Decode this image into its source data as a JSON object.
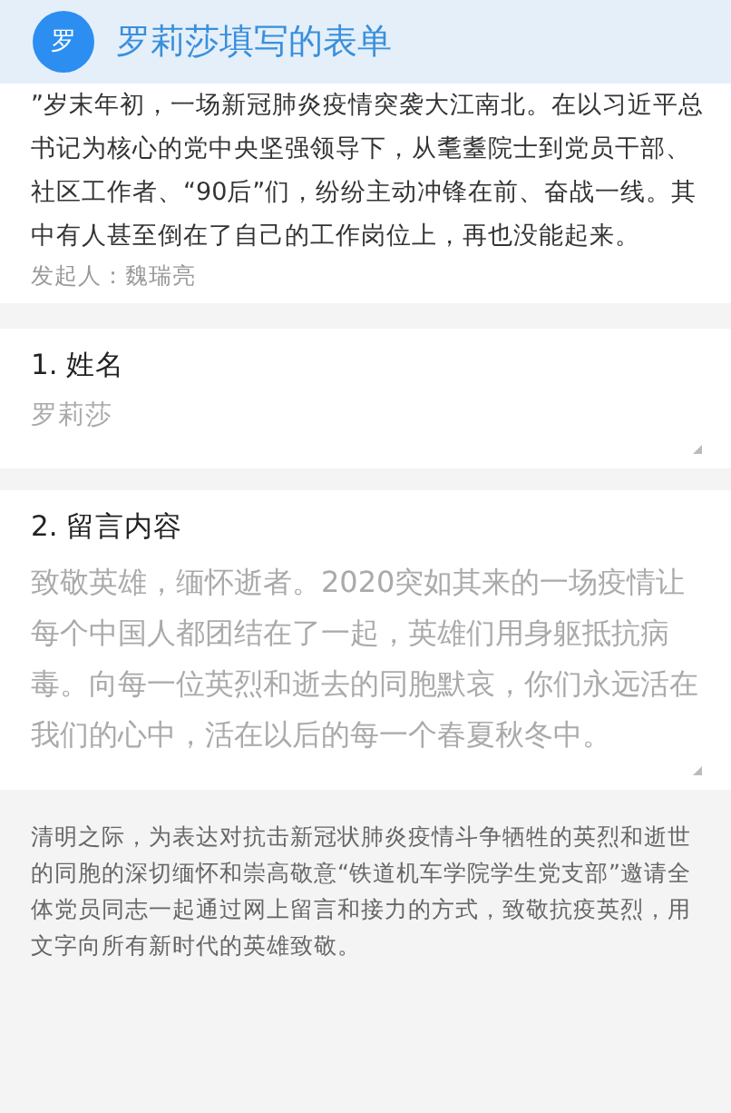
{
  "header": {
    "avatar": "罗",
    "title": "罗莉莎填写的表单"
  },
  "intro": {
    "text": "”岁末年初，一场新冠肺炎疫情突袭大江南北。在以习近平总书记为核心的党中央坚强领导下，从耄耋院士到党员干部、社区工作者、“90后”们，纷纷主动冲锋在前、奋战一线。其中有人甚至倒在了自己的工作岗位上，再也没能起来。",
    "initiator": "发起人：魏瑞亮"
  },
  "questions": [
    {
      "kind": "short",
      "title": "1. 姓名",
      "value": "罗莉莎"
    },
    {
      "kind": "long",
      "title": "2. 留言内容",
      "value": "致敬英雄，缅怀逝者。2020突如其来的一场疫情让每个中国人都团结在了一起，英雄们用身躯抵抗病毒。向每一位英烈和逝去的同胞默哀，你们永远活在我们的心中，活在以后的每一个春夏秋冬中。"
    }
  ],
  "footer": {
    "text": "清明之际，为表达对抗击新冠状肺炎疫情斗争牺牲的英烈和逝世的同胞的深切缅怀和崇高敬意“铁道机车学院学生党支部”邀请全体党员同志一起通过网上留言和接力的方式，致敬抗疫英烈，用文字向所有新时代的英雄致敬。"
  }
}
